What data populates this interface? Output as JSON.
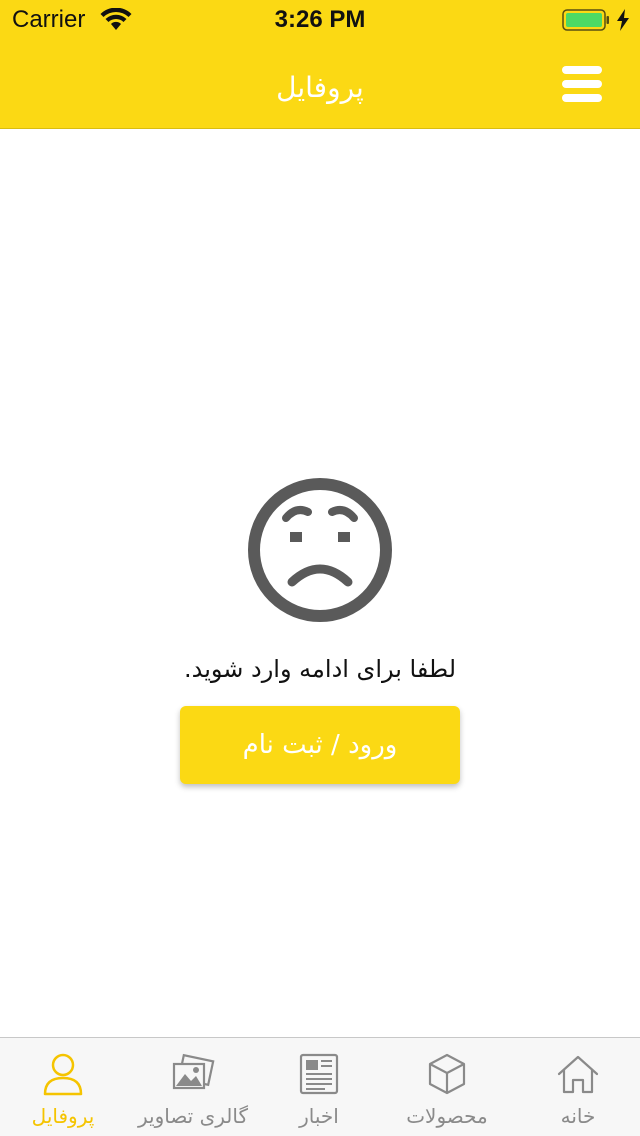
{
  "status_bar": {
    "carrier": "Carrier",
    "time": "3:26 PM",
    "battery_color": "#4CD964"
  },
  "nav": {
    "title": "پروفایل"
  },
  "content": {
    "prompt": "لطفا برای ادامه وارد شوید.",
    "login_button_label": "ورود / ثبت نام"
  },
  "tabs": [
    {
      "label": "پروفایل",
      "icon": "user-icon",
      "active": true
    },
    {
      "label": "گالری تصاویر",
      "icon": "gallery-icon",
      "active": false
    },
    {
      "label": "اخبار",
      "icon": "newspaper-icon",
      "active": false
    },
    {
      "label": "محصولات",
      "icon": "box-icon",
      "active": false
    },
    {
      "label": "خانه",
      "icon": "home-icon",
      "active": false
    }
  ],
  "colors": {
    "accent": "#FBD914",
    "tab_active": "#F5C400",
    "tab_inactive": "#8A8A8A"
  }
}
